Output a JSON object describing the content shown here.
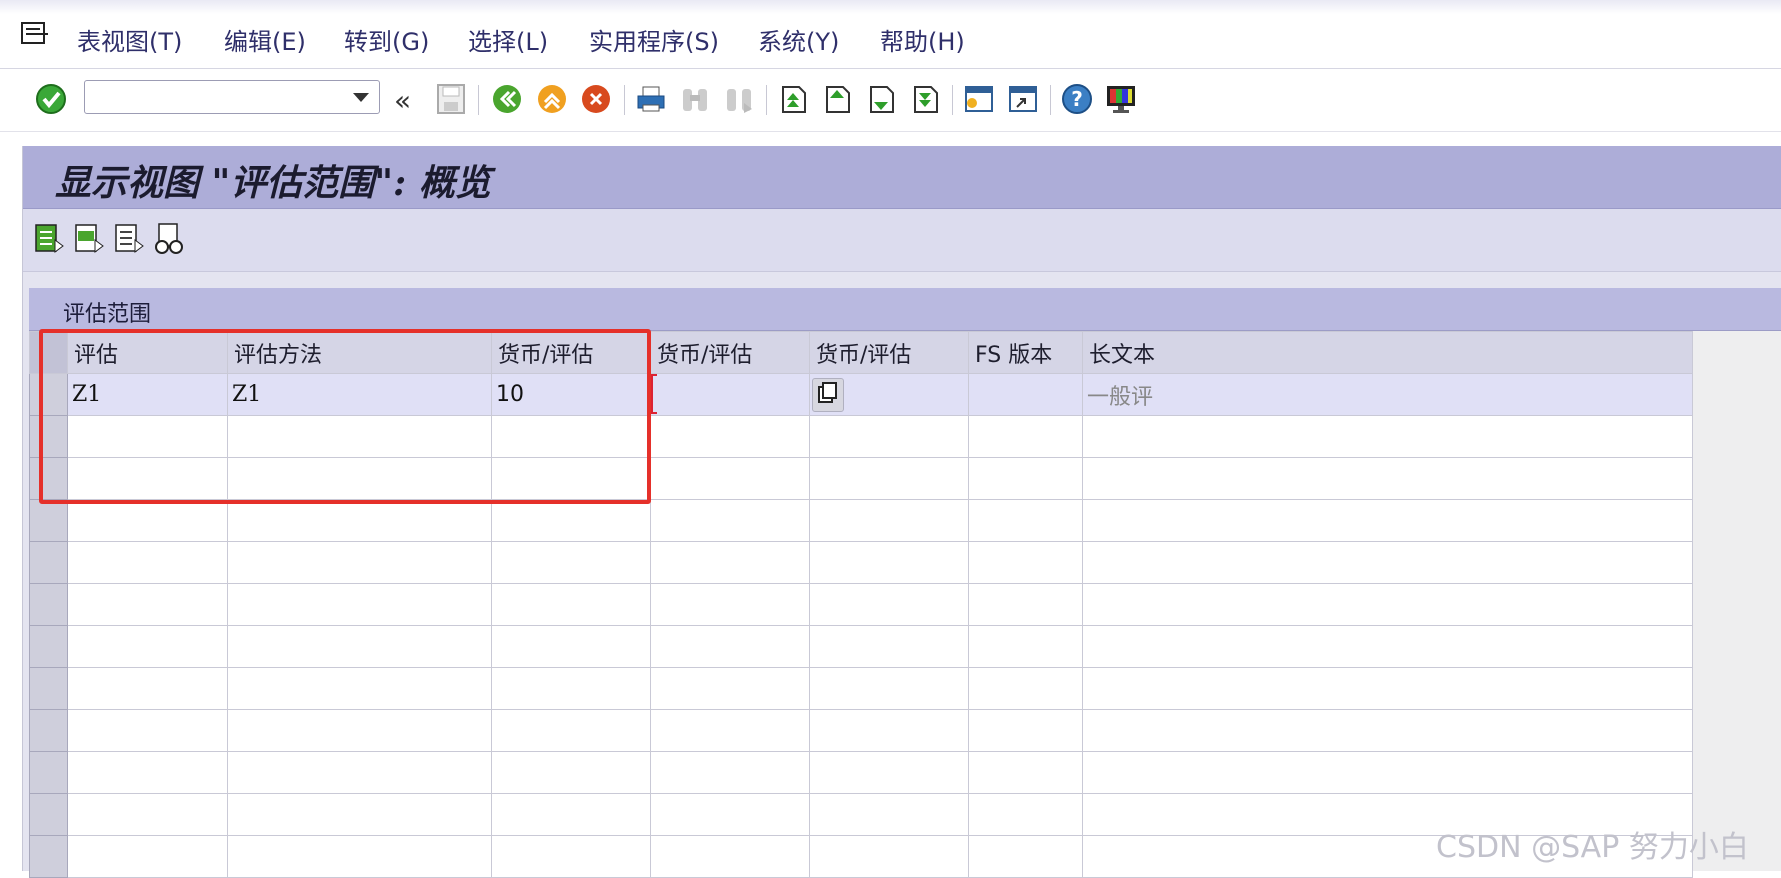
{
  "menu": {
    "items": [
      "表视图(T)",
      "编辑(E)",
      "转到(G)",
      "选择(L)",
      "实用程序(S)",
      "系统(Y)",
      "帮助(H)"
    ]
  },
  "toolbar": {
    "command_value": "",
    "icons": [
      "enter-icon",
      "back-icon",
      "save-icon",
      "green-back-icon",
      "exit-icon",
      "cancel-icon",
      "print-icon",
      "find-icon",
      "find-next-icon",
      "first-page-icon",
      "previous-page-icon",
      "next-page-icon",
      "last-page-icon",
      "create-session-icon",
      "shortcut-icon",
      "help-icon",
      "layout-icon"
    ]
  },
  "page": {
    "title": "显示视图 \"评估范围\": 概览",
    "app_toolbar_icons": [
      "select-all-icon",
      "select-block-icon",
      "deselect-all-icon",
      "glasses-icon"
    ]
  },
  "table": {
    "title": "评估范围",
    "columns": [
      "评估",
      "评估方法",
      "货币/评估",
      "货币/评估",
      "货币/评估",
      "FS 版本",
      "长文本"
    ],
    "rows": [
      [
        "Z1",
        "Z1",
        "10",
        "",
        "",
        "",
        "一般评"
      ]
    ],
    "empty_row_count": 11
  },
  "watermark": "CSDN @SAP 努力小白",
  "colors": {
    "title_bar": "#adadd8",
    "highlight": "#e5302a",
    "menu_text": "#2f2f6a"
  }
}
